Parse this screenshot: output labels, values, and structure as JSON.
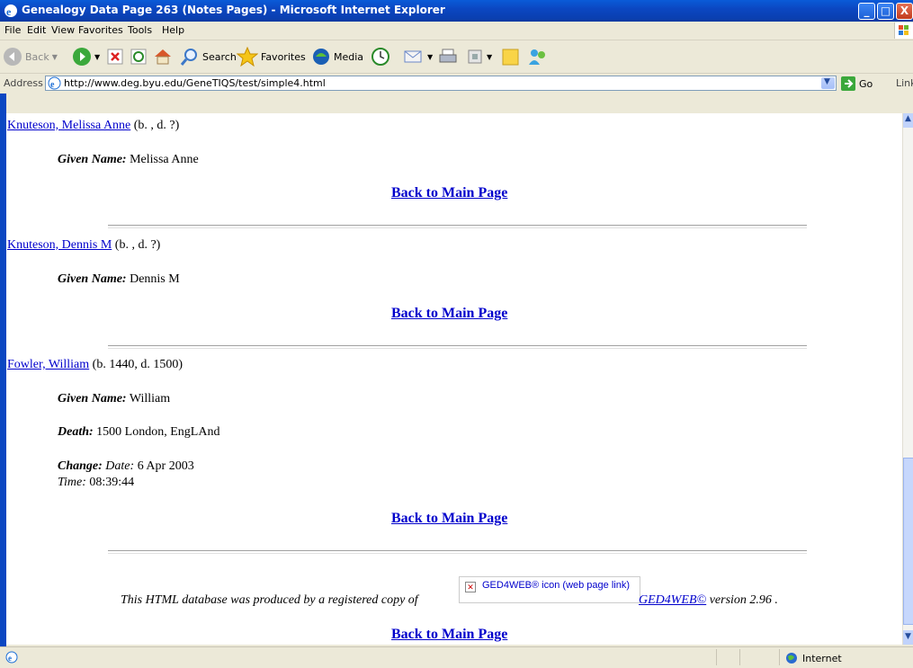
{
  "window": {
    "title": "Genealogy Data Page 263 (Notes Pages) - Microsoft Internet Explorer",
    "min_glyph": "_",
    "max_glyph": "□",
    "close_glyph": "X"
  },
  "menu": [
    "File",
    "Edit",
    "View",
    "Favorites",
    "Tools",
    "Help"
  ],
  "toolbar": {
    "back_label": "Back",
    "search_label": "Search",
    "favorites_label": "Favorites",
    "media_label": "Media"
  },
  "address": {
    "label": "Address",
    "url": "http://www.deg.byu.edu/GeneTIQS/test/simple4.html",
    "go_label": "Go",
    "links_label": "Links"
  },
  "entries": [
    {
      "name": "Knuteson, Melissa Anne",
      "dates": "(b. , d. ?)",
      "given_label": "Given Name:",
      "given_value": "Melissa Anne"
    },
    {
      "name": "Knuteson, Dennis M",
      "dates": "(b. , d. ?)",
      "given_label": "Given Name:",
      "given_value": "Dennis M"
    },
    {
      "name": "Fowler, William",
      "dates": "(b. 1440, d. 1500)",
      "given_label": "Given Name:",
      "given_value": "William",
      "death_label": "Death:",
      "death_value": "1500 London, EngLAnd",
      "change_label": "Change:",
      "date_label": "Date:",
      "date_value": "6 Apr 2003",
      "time_label": "Time:",
      "time_value": "08:39:44"
    }
  ],
  "back_link": "Back to Main Page",
  "footer": {
    "text": "This HTML database was produced by a registered copy of",
    "broken_image_alt": "GED4WEB® icon (web page link)",
    "product_link": "GED4WEB©",
    "version": "version 2.96 ."
  },
  "status": {
    "zone": "Internet"
  }
}
